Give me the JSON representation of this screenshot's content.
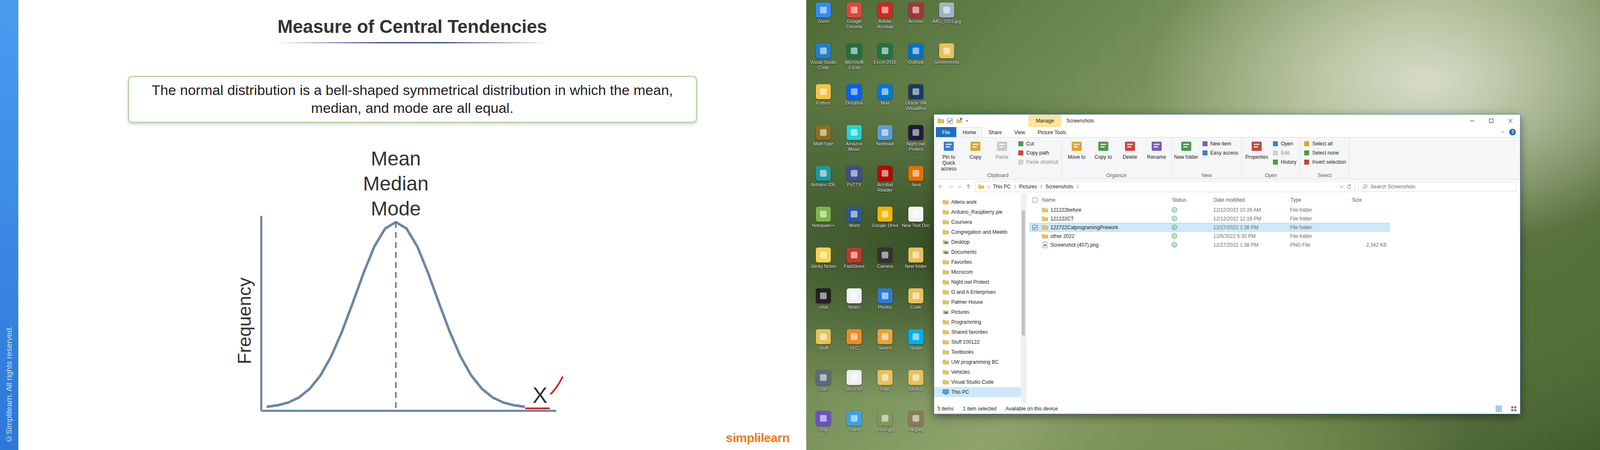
{
  "slide": {
    "title": "Measure of Central Tendencies",
    "definition": "The normal distribution is a bell-shaped symmetrical distribution in which the mean, median, and mode are all equal.",
    "chart": {
      "labels": [
        "Mean",
        "Median",
        "Mode"
      ],
      "y_axis": "Frequency",
      "x_axis": "X",
      "curve": [
        0.006,
        0.014,
        0.029,
        0.056,
        0.103,
        0.175,
        0.278,
        0.411,
        0.566,
        0.726,
        0.868,
        0.965,
        1,
        0.965,
        0.868,
        0.726,
        0.566,
        0.411,
        0.278,
        0.175,
        0.103,
        0.056,
        0.029,
        0.014,
        0.006
      ]
    },
    "watermark": "©Simplilearn. All rights reserved.",
    "logo": "simplilearn"
  },
  "desktop": {
    "icons": [
      {
        "label": "Zoom",
        "color": "#2d8cff"
      },
      {
        "label": "Visual Studio Code",
        "color": "#1f7fd1"
      },
      {
        "label": "Python",
        "color": "#f5c342"
      },
      {
        "label": "MathType",
        "color": "#8a6d1e"
      },
      {
        "label": "Arduino IDE",
        "color": "#1b9aa0"
      },
      {
        "label": "Notepad++",
        "color": "#7ab648"
      },
      {
        "label": "Sticky Notes",
        "color": "#f2d64b"
      },
      {
        "label": "cmd",
        "color": "#222222"
      },
      {
        "label": "Stuff",
        "color": "#e8c15a"
      },
      {
        "label": "Calc",
        "color": "#5b6b7a"
      },
      {
        "label": "Snip",
        "color": "#6d4fc2"
      },
      {
        "label": "Google Chrome",
        "color": "#e0463a"
      },
      {
        "label": "Microsoft Excel",
        "color": "#1e7145"
      },
      {
        "label": "Dropbox",
        "color": "#0061fe"
      },
      {
        "label": "Amazon Music",
        "color": "#25d1da"
      },
      {
        "label": "PuTTY",
        "color": "#3c4f8f"
      },
      {
        "label": "Word",
        "color": "#2b579a"
      },
      {
        "label": "FastStone",
        "color": "#c2372e"
      },
      {
        "label": "Notes",
        "color": "#f0f0f0"
      },
      {
        "label": "VLC",
        "color": "#f08a24"
      },
      {
        "label": "docs.txt",
        "color": "#eeeeee"
      },
      {
        "label": "Paint",
        "color": "#3aa0e8"
      },
      {
        "label": "Adobe Acrobat",
        "color": "#d4271f"
      },
      {
        "label": "Excel 2016",
        "color": "#217346"
      },
      {
        "label": "Mail",
        "color": "#0078d4"
      },
      {
        "label": "Notepad",
        "color": "#5c9bd5"
      },
      {
        "label": "Acrobat Reader",
        "color": "#b30b00"
      },
      {
        "label": "Google Drive",
        "color": "#f4b400"
      },
      {
        "label": "Camera",
        "color": "#333333"
      },
      {
        "label": "Photos",
        "color": "#2a7bd4"
      },
      {
        "label": "Sketch",
        "color": "#e6a23c"
      },
      {
        "label": "Logs",
        "color": "#e8c15a"
      },
      {
        "label": "photo.jpg",
        "color": "#7d9a5e"
      },
      {
        "label": "Access",
        "color": "#a4373a"
      },
      {
        "label": "Outlook",
        "color": "#0072c6"
      },
      {
        "label": "Oracle VM VirtualBox",
        "color": "#183a61"
      },
      {
        "label": "Night owl Protect",
        "color": "#1c1c3c"
      },
      {
        "label": "Java",
        "color": "#e76f00"
      },
      {
        "label": "New Text Doc",
        "color": "#f3f3f3"
      },
      {
        "label": "New folder",
        "color": "#e8c15a"
      },
      {
        "label": "Code",
        "color": "#e8c15a"
      },
      {
        "label": "Skype",
        "color": "#00aff0"
      },
      {
        "label": "Backup",
        "color": "#e8c15a"
      },
      {
        "label": "cat.jpeg",
        "color": "#8b7a5a"
      },
      {
        "label": "IMG_2201.jpg",
        "color": "#9fb3c8"
      },
      {
        "label": "Screenshots",
        "color": "#e8c15a"
      }
    ]
  },
  "explorer": {
    "window": {
      "title": "Screenshots",
      "context_tab": "Manage"
    },
    "tabs": [
      {
        "label": "File",
        "kind": "file",
        "selected": false
      },
      {
        "label": "Home",
        "kind": "tab",
        "selected": true
      },
      {
        "label": "Share",
        "kind": "tab",
        "selected": false
      },
      {
        "label": "View",
        "kind": "tab",
        "selected": false
      },
      {
        "label": "Picture Tools",
        "kind": "tab",
        "selected": false
      }
    ],
    "help": "?",
    "ribbon": [
      {
        "label": "Clipboard",
        "items": [
          {
            "label": "Pin to Quick access",
            "kind": "large",
            "disabled": false
          },
          {
            "label": "Copy",
            "kind": "large",
            "disabled": false
          },
          {
            "label": "Paste",
            "kind": "large",
            "disabled": true
          },
          {
            "label": "Cut",
            "kind": "small",
            "disabled": false
          },
          {
            "label": "Copy path",
            "kind": "small",
            "disabled": false
          },
          {
            "label": "Paste shortcut",
            "kind": "small",
            "disabled": true
          }
        ]
      },
      {
        "label": "Organize",
        "items": [
          {
            "label": "Move to",
            "kind": "large",
            "disabled": false
          },
          {
            "label": "Copy to",
            "kind": "large",
            "disabled": false
          },
          {
            "label": "Delete",
            "kind": "large",
            "disabled": false
          },
          {
            "label": "Rename",
            "kind": "large",
            "disabled": false
          }
        ]
      },
      {
        "label": "New",
        "items": [
          {
            "label": "New folder",
            "kind": "large",
            "disabled": false
          },
          {
            "label": "New item",
            "kind": "small",
            "disabled": false
          },
          {
            "label": "Easy access",
            "kind": "small",
            "disabled": false
          }
        ]
      },
      {
        "label": "Open",
        "items": [
          {
            "label": "Properties",
            "kind": "large",
            "disabled": false
          },
          {
            "label": "Open",
            "kind": "small",
            "disabled": false
          },
          {
            "label": "Edit",
            "kind": "small",
            "disabled": true
          },
          {
            "label": "History",
            "kind": "small",
            "disabled": false
          }
        ]
      },
      {
        "label": "Select",
        "items": [
          {
            "label": "Select all",
            "kind": "small",
            "disabled": false
          },
          {
            "label": "Select none",
            "kind": "small",
            "disabled": false
          },
          {
            "label": "Invert selection",
            "kind": "small",
            "disabled": false
          }
        ]
      }
    ],
    "address": {
      "path": [
        "This PC",
        "Pictures",
        "Screenshots"
      ]
    },
    "search": {
      "placeholder": "Search Screenshots"
    },
    "nav": [
      {
        "label": "Allens work",
        "kind": "folder",
        "selected": false
      },
      {
        "label": "Arduino_Raspberry pie",
        "kind": "folder",
        "selected": false
      },
      {
        "label": "Coursera",
        "kind": "folder",
        "selected": false
      },
      {
        "label": "Congregation and Meetin",
        "kind": "folder",
        "selected": false
      },
      {
        "label": "Desktop",
        "kind": "special",
        "selected": false
      },
      {
        "label": "Documents",
        "kind": "special",
        "selected": false
      },
      {
        "label": "Favorites",
        "kind": "folder",
        "selected": false
      },
      {
        "label": "Microcom",
        "kind": "folder",
        "selected": false
      },
      {
        "label": "Night owl Protect",
        "kind": "folder",
        "selected": false
      },
      {
        "label": "O and A Enterprises",
        "kind": "folder",
        "selected": false
      },
      {
        "label": "Palmer House",
        "kind": "folder",
        "selected": false
      },
      {
        "label": "Pictures",
        "kind": "special",
        "selected": false
      },
      {
        "label": "Programming",
        "kind": "folder",
        "selected": false
      },
      {
        "label": "Shared favorites",
        "kind": "folder",
        "selected": false
      },
      {
        "label": "Stuff 100122",
        "kind": "folder",
        "selected": false
      },
      {
        "label": "Textbooks",
        "kind": "folder",
        "selected": false
      },
      {
        "label": "UW programming BC",
        "kind": "folder",
        "selected": false
      },
      {
        "label": "Vehicles",
        "kind": "folder",
        "selected": false
      },
      {
        "label": "Visual Studio Code",
        "kind": "folder",
        "selected": false
      },
      {
        "label": "This PC",
        "kind": "pc",
        "selected": true
      }
    ],
    "columns": [
      "Name",
      "Status",
      "Date modified",
      "Type",
      "Size"
    ],
    "rows": [
      {
        "name": "121222before",
        "kind": "folder",
        "synced": true,
        "date": "12/12/2022 10:26 AM",
        "type": "File folder",
        "size": "",
        "selected": false
      },
      {
        "name": "121222CT",
        "kind": "folder",
        "synced": true,
        "date": "12/12/2022 12:16 PM",
        "type": "File folder",
        "size": "",
        "selected": false
      },
      {
        "name": "122722CalprogramingPrework",
        "kind": "folder",
        "synced": true,
        "date": "12/27/2022 1:36 PM",
        "type": "File folder",
        "size": "",
        "selected": true
      },
      {
        "name": "other 2022",
        "kind": "folder",
        "synced": true,
        "date": "12/5/2022 5:30 PM",
        "type": "File folder",
        "size": "",
        "selected": false
      },
      {
        "name": "Screenshot (407).png",
        "kind": "file",
        "synced": true,
        "date": "12/27/2022 1:38 PM",
        "type": "PNG File",
        "size": "2,342 KB",
        "selected": false
      }
    ],
    "status_bar": {
      "count": "5 items",
      "selection": "1 item selected",
      "availability": "Available on this device"
    }
  }
}
